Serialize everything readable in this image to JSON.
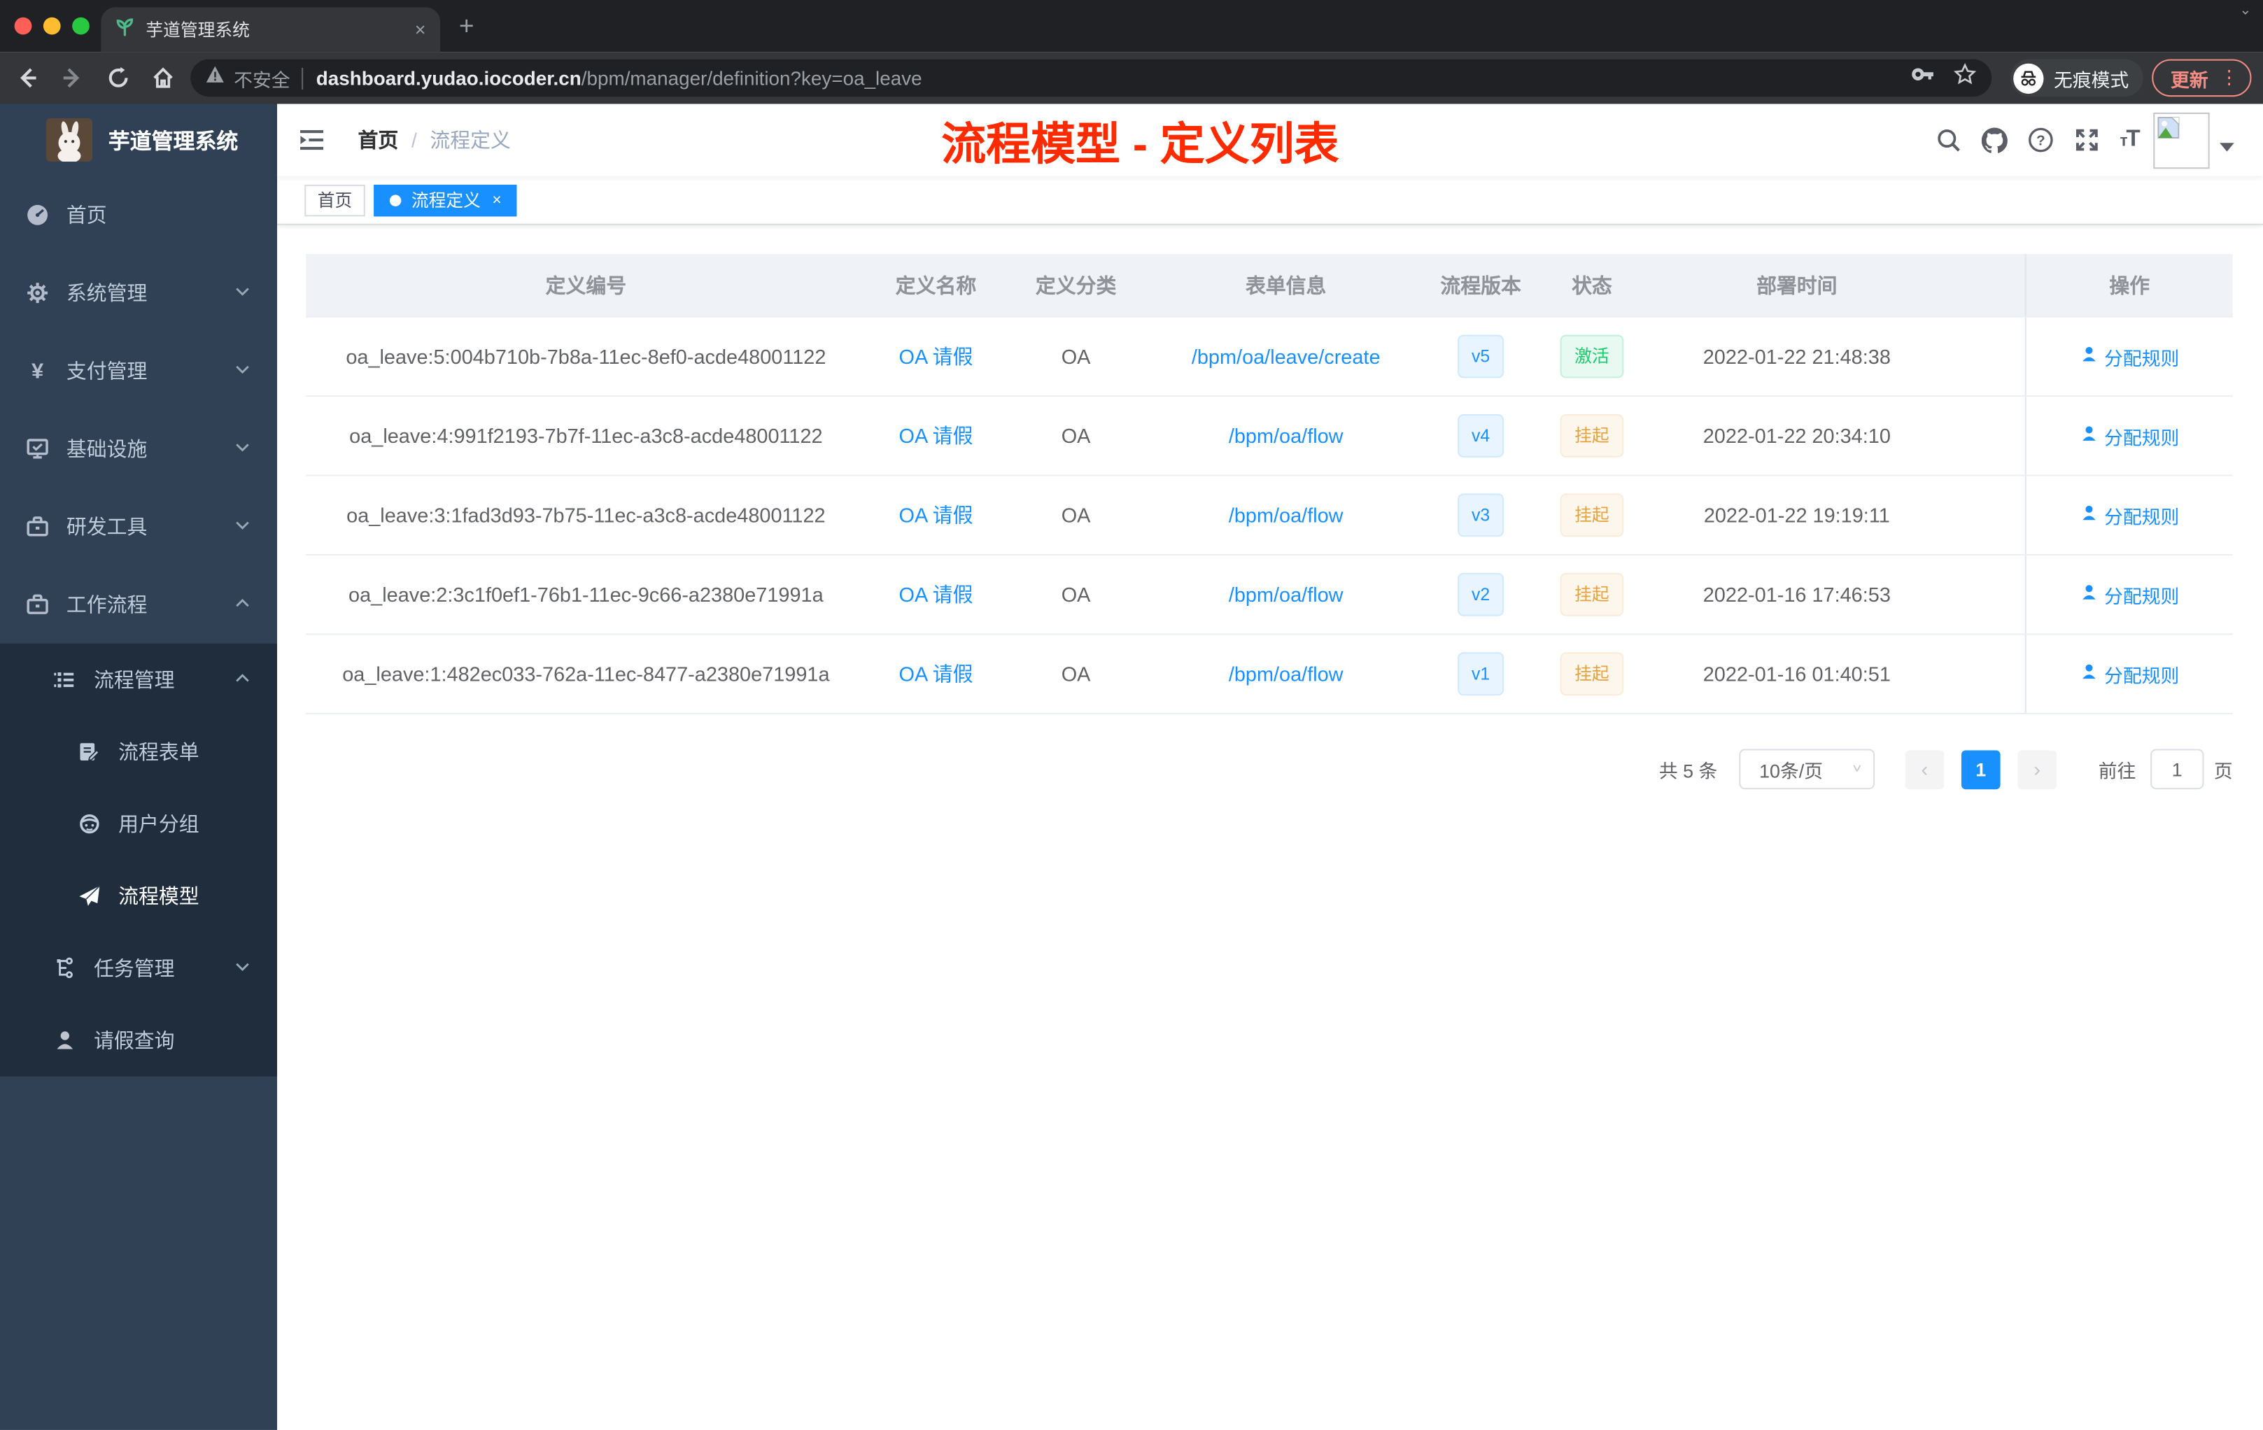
{
  "colors": {
    "primary": "#1890ff",
    "sidebar_bg": "#304156",
    "submenu_bg": "#1f2d3d",
    "annotation": "#fe2b00",
    "success": "#13ce66",
    "warning": "#e6a23c",
    "tag_active": "#1890ff"
  },
  "browser": {
    "tab_title": "芋道管理系统",
    "tab_close": "×",
    "new_tab": "+",
    "security_label": "不安全",
    "url_host": "dashboard.yudao.iocoder.cn",
    "url_path": "/bpm/manager/definition?key=oa_leave",
    "incognito_label": "无痕模式",
    "update_label": "更新",
    "menu_dots": "⋮"
  },
  "sidebar": {
    "app_title": "芋道管理系统",
    "items": [
      {
        "label": "首页",
        "icon": "dashboard-icon",
        "level": 0,
        "chevron": "",
        "group": false,
        "active": false
      },
      {
        "label": "系统管理",
        "icon": "gear-icon",
        "level": 0,
        "chevron": "down",
        "group": false,
        "active": false
      },
      {
        "label": "支付管理",
        "icon": "yen-icon",
        "level": 0,
        "chevron": "down",
        "group": false,
        "active": false
      },
      {
        "label": "基础设施",
        "icon": "monitor-icon",
        "level": 0,
        "chevron": "down",
        "group": false,
        "active": false
      },
      {
        "label": "研发工具",
        "icon": "briefcase-icon",
        "level": 0,
        "chevron": "down",
        "group": false,
        "active": false
      },
      {
        "label": "工作流程",
        "icon": "briefcase-icon",
        "level": 0,
        "chevron": "up",
        "group": false,
        "active": false
      },
      {
        "label": "流程管理",
        "icon": "list-icon",
        "level": 1,
        "chevron": "up",
        "group": true,
        "active": false
      },
      {
        "label": "流程表单",
        "icon": "form-icon",
        "level": 2,
        "chevron": "",
        "group": true,
        "active": false
      },
      {
        "label": "用户分组",
        "icon": "user-group-icon",
        "level": 2,
        "chevron": "",
        "group": true,
        "active": false
      },
      {
        "label": "流程模型",
        "icon": "paper-plane-icon",
        "level": 2,
        "chevron": "",
        "group": true,
        "active": true
      },
      {
        "label": "任务管理",
        "icon": "tree-icon",
        "level": 1,
        "chevron": "down",
        "group": true,
        "active": false
      },
      {
        "label": "请假查询",
        "icon": "person-icon",
        "level": 1,
        "chevron": "",
        "group": true,
        "active": false
      }
    ]
  },
  "header": {
    "breadcrumb_first": "首页",
    "breadcrumb_separator": "/",
    "breadcrumb_last": "流程定义",
    "annotation": "流程模型 - 定义列表"
  },
  "tags": {
    "home": "首页",
    "active": "流程定义",
    "close": "×"
  },
  "table": {
    "columns": [
      "定义编号",
      "定义名称",
      "定义分类",
      "表单信息",
      "流程版本",
      "状态",
      "部署时间",
      "",
      "操作"
    ],
    "action_label": "分配规则",
    "rows": [
      {
        "id": "oa_leave:5:004b710b-7b8a-11ec-8ef0-acde48001122",
        "name": "OA 请假",
        "category": "OA",
        "form": "/bpm/oa/leave/create",
        "version": "v5",
        "status": "激活",
        "status_type": "success",
        "deploy_time": "2022-01-22 21:48:38",
        "action": "分配规则"
      },
      {
        "id": "oa_leave:4:991f2193-7b7f-11ec-a3c8-acde48001122",
        "name": "OA 请假",
        "category": "OA",
        "form": "/bpm/oa/flow",
        "version": "v4",
        "status": "挂起",
        "status_type": "warning",
        "deploy_time": "2022-01-22 20:34:10",
        "action": "分配规则"
      },
      {
        "id": "oa_leave:3:1fad3d93-7b75-11ec-a3c8-acde48001122",
        "name": "OA 请假",
        "category": "OA",
        "form": "/bpm/oa/flow",
        "version": "v3",
        "status": "挂起",
        "status_type": "warning",
        "deploy_time": "2022-01-22 19:19:11",
        "action": "分配规则"
      },
      {
        "id": "oa_leave:2:3c1f0ef1-76b1-11ec-9c66-a2380e71991a",
        "name": "OA 请假",
        "category": "OA",
        "form": "/bpm/oa/flow",
        "version": "v2",
        "status": "挂起",
        "status_type": "warning",
        "deploy_time": "2022-01-16 17:46:53",
        "action": "分配规则"
      },
      {
        "id": "oa_leave:1:482ec033-762a-11ec-8477-a2380e71991a",
        "name": "OA 请假",
        "category": "OA",
        "form": "/bpm/oa/flow",
        "version": "v1",
        "status": "挂起",
        "status_type": "warning",
        "deploy_time": "2022-01-16 01:40:51",
        "action": "分配规则"
      }
    ]
  },
  "pagination": {
    "total": "共 5 条",
    "page_size": "10条/页",
    "prev": "‹",
    "current_page": "1",
    "next": "›",
    "goto_label": "前往",
    "goto_value": "1",
    "page_unit": "页"
  }
}
